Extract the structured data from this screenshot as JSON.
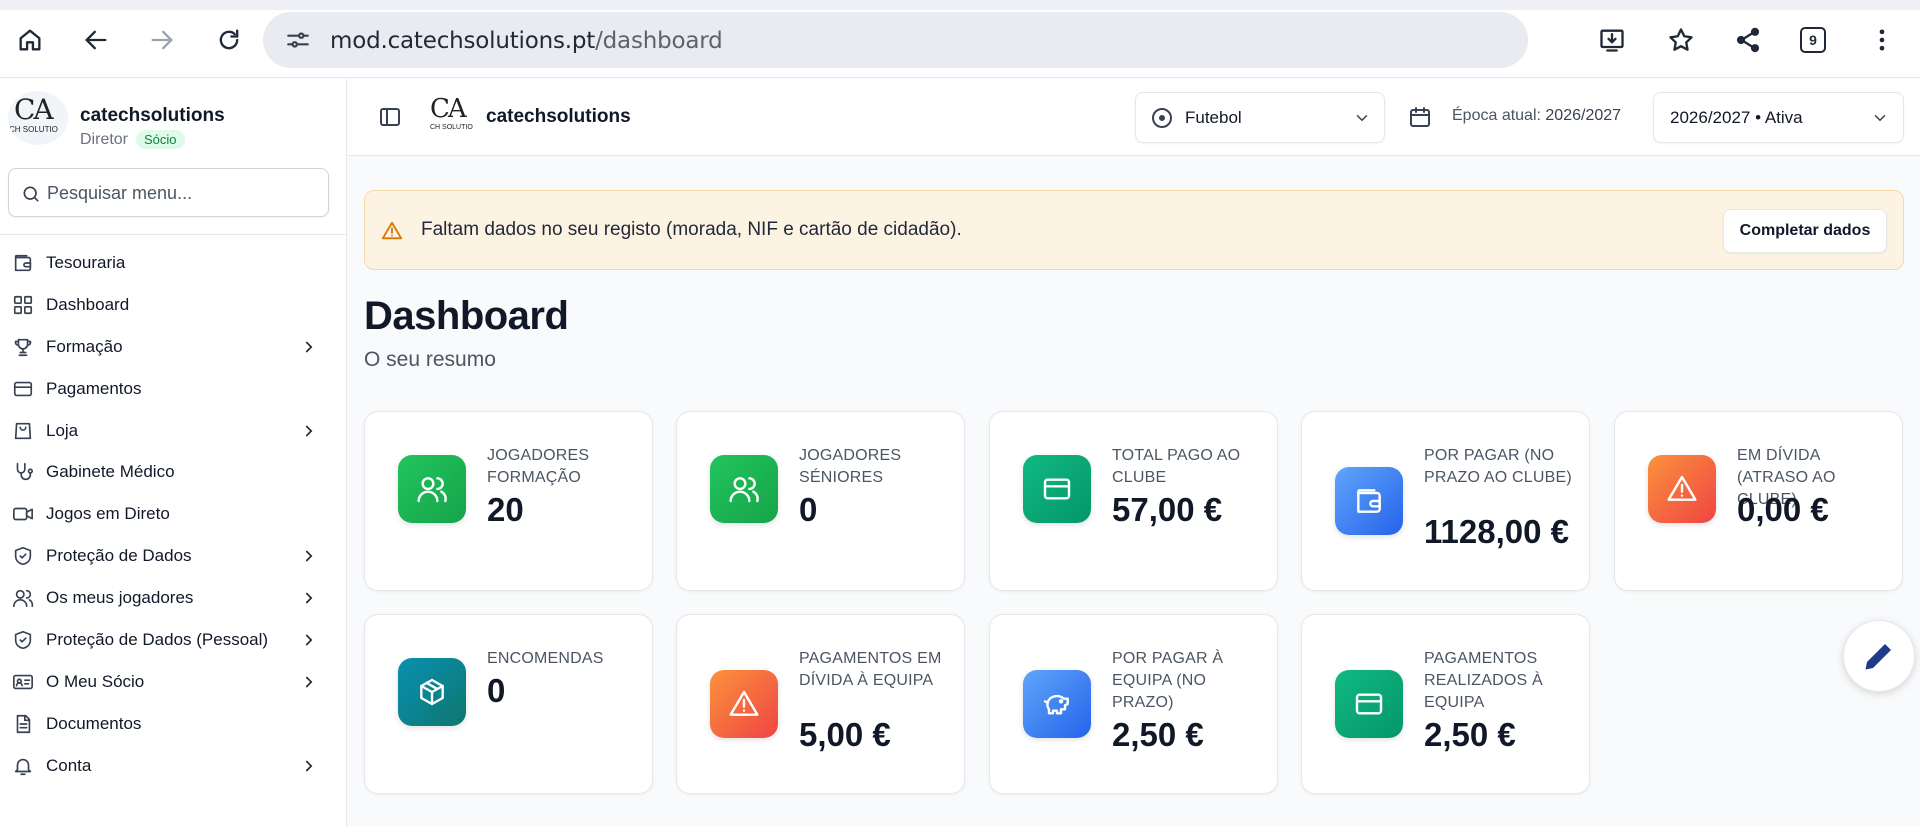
{
  "browser": {
    "url_host": "mod.catechsolutions.pt",
    "url_path": "/dashboard",
    "tab_count": "9"
  },
  "sidebar": {
    "brand_name": "catechsolutions",
    "logo_text": "CA",
    "logo_subtext": "CH SOLUTIO",
    "role": "Diretor",
    "role_badge": "Sócio",
    "search_placeholder": "Pesquisar menu...",
    "items": [
      {
        "label": "Tesouraria",
        "icon": "wallet-icon",
        "has_children": false
      },
      {
        "label": "Dashboard",
        "icon": "grid-icon",
        "has_children": false
      },
      {
        "label": "Formação",
        "icon": "trophy-icon",
        "has_children": true
      },
      {
        "label": "Pagamentos",
        "icon": "credit-card-icon",
        "has_children": false
      },
      {
        "label": "Loja",
        "icon": "shopping-bag-icon",
        "has_children": true
      },
      {
        "label": "Gabinete Médico",
        "icon": "stethoscope-icon",
        "has_children": false
      },
      {
        "label": "Jogos em Direto",
        "icon": "video-icon",
        "has_children": false
      },
      {
        "label": "Proteção de Dados",
        "icon": "shield-check-icon",
        "has_children": true
      },
      {
        "label": "Os meus jogadores",
        "icon": "users-icon",
        "has_children": true
      },
      {
        "label": "Proteção de Dados (Pessoal)",
        "icon": "shield-check-icon",
        "has_children": true
      },
      {
        "label": "O Meu Sócio",
        "icon": "id-card-icon",
        "has_children": true
      },
      {
        "label": "Documentos",
        "icon": "document-icon",
        "has_children": false
      },
      {
        "label": "Conta",
        "icon": "bell-icon",
        "has_children": true
      }
    ]
  },
  "header": {
    "brand_name": "catechsolutions",
    "logo_text": "CA",
    "logo_subtext": "CH SOLUTIO",
    "sport_selected": "Futebol",
    "epoca_label": "Época atual: ",
    "epoca_value": "2026/2027",
    "season_selected": "2026/2027 • Ativa"
  },
  "alert": {
    "message": "Faltam dados no seu registo (morada, NIF e cartão de cidadão).",
    "button_label": "Completar dados"
  },
  "page": {
    "title": "Dashboard",
    "subtitle": "O seu resumo"
  },
  "cards": [
    {
      "label": "Jogadores Formação",
      "value": "20",
      "icon": "users-icon",
      "color": "#16a34a"
    },
    {
      "label": "Jogadores Séniores",
      "value": "0",
      "icon": "users-icon",
      "color": "#16a34a"
    },
    {
      "label": "Total pago ao clube",
      "value": "57,00 €",
      "icon": "credit-card-icon",
      "color": "#059669"
    },
    {
      "label": "Por pagar (no prazo ao clube)",
      "value": "1128,00 €",
      "icon": "wallet-icon",
      "color": "#2563eb"
    },
    {
      "label": "Em dívida (atraso ao clube)",
      "value": "0,00 €",
      "icon": "alert-triangle-icon",
      "color": "#ef4444"
    },
    {
      "label": "Encomendas",
      "value": "0",
      "icon": "package-icon",
      "color": "#0f766e"
    },
    {
      "label": "Pagamentos em dívida à equipa",
      "value": "5,00 €",
      "icon": "alert-triangle-icon",
      "color": "#ef4444"
    },
    {
      "label": "Por pagar à equipa (no prazo)",
      "value": "2,50 €",
      "icon": "piggy-bank-icon",
      "color": "#2563eb"
    },
    {
      "label": "Pagamentos realizados à equipa",
      "value": "2,50 €",
      "icon": "credit-card-icon",
      "color": "#059669"
    }
  ]
}
